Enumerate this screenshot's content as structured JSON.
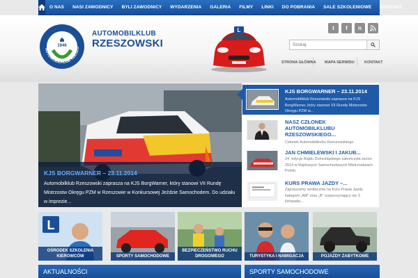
{
  "topnav": {
    "items": [
      "O NAS",
      "NASI ZAWODNICY",
      "BYLI ZAWODNICY",
      "WYDARZENIA",
      "GALERIA",
      "FILMY",
      "LINKI",
      "DO POBRANIA",
      "SALE SZKOLENIOWE",
      "KONTAKT"
    ]
  },
  "header": {
    "logo_year": "1946",
    "logo_ring_text": "AUTOMOBILKLUB RZESZOWSKI",
    "brand_line1": "AUTOMOBILKLUB",
    "brand_line2": "RZESZOWSKI",
    "car_badge": "L"
  },
  "social": [
    "t",
    "f",
    "n",
    "rss"
  ],
  "search": {
    "placeholder": "Szukaj"
  },
  "subnav": [
    "STRONA GŁÓWNA",
    "MAPA SERWISU",
    "KONTAKT"
  ],
  "slider": {
    "title": "KJS BORGWARNER – 23.11.2014",
    "text": "Automobilklub Rzeszowski zaprasza na KJS BorgWarner, który stanowi VII Rundę Mistrzostw Okręgu PZM w Rzeszowie w Konkursowej Jeździe Samochodem. Do udziału w imprezie..."
  },
  "news": [
    {
      "title": "KJS BORGWARNER – 23.11.2014",
      "desc": "Automobilklub Rzeszowski zaprasza na KJS BorgWarner, który stanowi VII Rundę Mistrzostw Okręgu PZM w..."
    },
    {
      "title": "NASZ CZŁONEK AUTOMOBILKLUBU RZESZOWSKIEGO...",
      "desc": "Członek Automobilklubu Rzeszowskiego"
    },
    {
      "title": "JAN CHMIELEWSKI I JAKUB...",
      "desc": "24. edycja Rajdu Dolnośląskiego zakończyła sezon 2014 w Rajdowych Samochodowych Mistrzostwach Polski."
    },
    {
      "title": "KURS PRAWA JAZDY –...",
      "desc": "Zapraszamy serdecznie na Kurs Prawa Jazdy kategorii „AM” oraz „B” rozpoczynający się 3 listopada..."
    }
  ],
  "tiles": [
    {
      "label": "OŚRODEK SZKOLENIA KIEROWCÓW"
    },
    {
      "label": "SPORTY SAMOCHODOWE"
    },
    {
      "label": "BEZPIECZEŃSTWO RUCHU DROGOWEGO"
    },
    {
      "label": "TURYSTYKA I NAWIGACJA"
    },
    {
      "label": "POJAZDY ZABYTKOWE"
    }
  ],
  "sections": [
    "AKTUALNOŚCI",
    "SPORTY SAMOCHODOWE"
  ],
  "colors": {
    "nav": "#1e5aa8",
    "accent": "#5fb0ff",
    "brand": "#1a4f98"
  }
}
